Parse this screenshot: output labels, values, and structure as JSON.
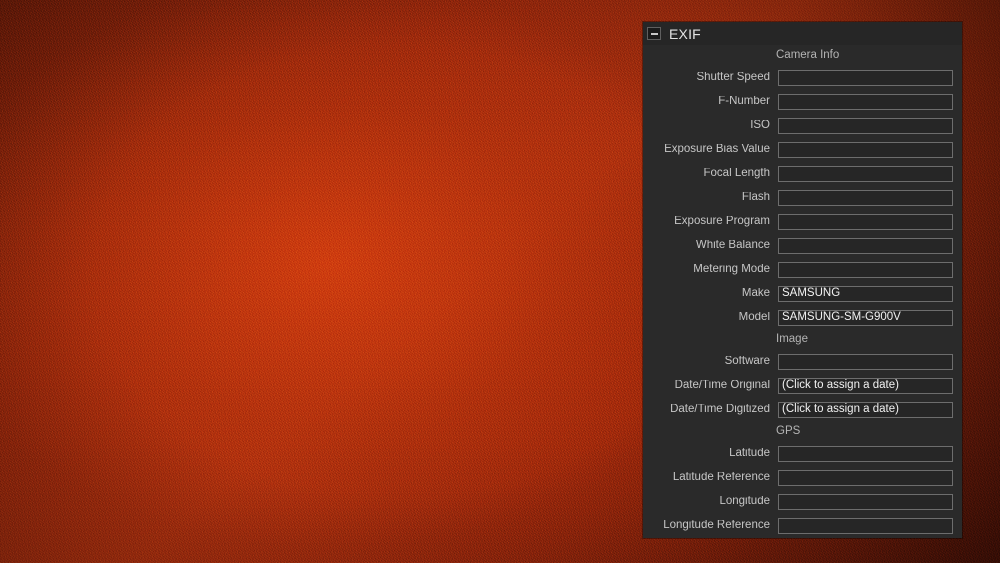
{
  "background": {
    "description": "red-rust noisy texture",
    "base_color": "#9e3413",
    "highlight_color": "#c2551a",
    "shadow_color": "#6d2210"
  },
  "panel": {
    "title": "EXIF",
    "collapse_icon": "minus-icon",
    "colors": {
      "panel_bg": "#2a2a2a",
      "header_bg": "#262626",
      "input_bg": "#262626",
      "input_border": "#6d6d6d",
      "label_text": "#c6c6c6",
      "value_text": "#f2f2f2",
      "section_text": "#b4b4b4"
    },
    "sections": [
      {
        "name": "Camera Info",
        "fields": [
          {
            "label": "Shutter Speed",
            "value": ""
          },
          {
            "label": "F-Number",
            "value": ""
          },
          {
            "label": "ISO",
            "value": ""
          },
          {
            "label": "Exposure Bias Value",
            "value": ""
          },
          {
            "label": "Focal Length",
            "value": ""
          },
          {
            "label": "Flash",
            "value": ""
          },
          {
            "label": "Exposure Program",
            "value": ""
          },
          {
            "label": "White Balance",
            "value": ""
          },
          {
            "label": "Metering Mode",
            "value": ""
          },
          {
            "label": "Make",
            "value": "SAMSUNG"
          },
          {
            "label": "Model",
            "value": "SAMSUNG-SM-G900V"
          }
        ]
      },
      {
        "name": "Image",
        "fields": [
          {
            "label": "Software",
            "value": ""
          },
          {
            "label": "Date/Time Original",
            "value": "(Click to assign a date)"
          },
          {
            "label": "Date/Time Digitized",
            "value": "(Click to assign a date)"
          }
        ]
      },
      {
        "name": "GPS",
        "fields": [
          {
            "label": "Latitude",
            "value": ""
          },
          {
            "label": "Latitude Reference",
            "value": ""
          },
          {
            "label": "Longitude",
            "value": ""
          },
          {
            "label": "Longitude Reference",
            "value": ""
          }
        ]
      }
    ]
  }
}
